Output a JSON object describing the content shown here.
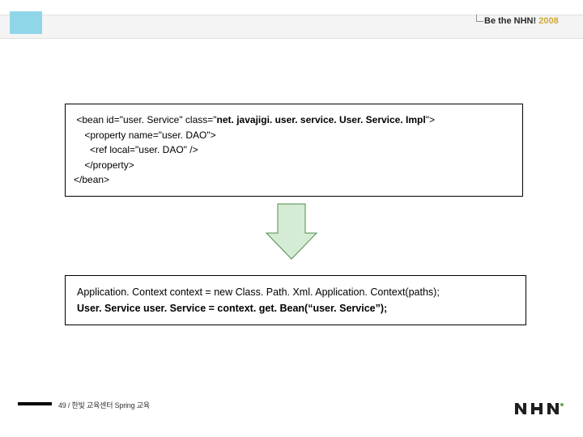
{
  "header": {
    "brand_prefix": "Be the NHN!",
    "brand_year": "2008"
  },
  "codebox1": {
    "l1_a": " <bean id=\"user. Service\" class=\"",
    "l1_b": "net. javajigi. user. service. User. Service. Impl",
    "l1_c": "\">",
    "l2": "    <property name=\"user. DAO\">",
    "l3": "      <ref local=\"user. DAO\" />",
    "l4": "    </property>",
    "l5": "</bean>"
  },
  "codebox2": {
    "l1": "Application. Context context = new Class. Path. Xml. Application. Context(paths);",
    "l2": "User. Service user. Service = context. get. Bean(“user. Service”);"
  },
  "footer": {
    "label": "49 / 한빛 교육센터 Spring 교육"
  },
  "logo": {
    "text": "nhn"
  },
  "colors": {
    "arrow_fill": "#d6ebd6",
    "arrow_stroke": "#4b8f4b",
    "chip": "#8fd6e8"
  }
}
